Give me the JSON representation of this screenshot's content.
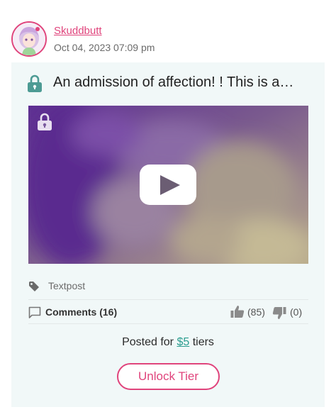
{
  "post": {
    "author": "Skuddbutt",
    "date": "Oct 04, 2023 07:09 pm",
    "title": "An admission of affection! ! This is a…",
    "tag": "Textpost",
    "comments_label": "Comments (16)",
    "likes": "(85)",
    "dislikes": "(0)",
    "posted_prefix": "Posted for ",
    "tier_price": "$5",
    "posted_suffix": " tiers",
    "unlock_label": "Unlock Tier"
  },
  "icons": {
    "title_lock": "lock-icon",
    "video_lock": "lock-icon",
    "play": "play-icon",
    "tag": "tag-icon",
    "comment": "comment-icon",
    "like": "thumbs-up-icon",
    "dislike": "thumbs-down-icon"
  },
  "colors": {
    "accent_pink": "#e0447c",
    "teal": "#2a9d8f",
    "card_bg": "#f1f8f8",
    "lock_teal": "#4d9b94"
  }
}
